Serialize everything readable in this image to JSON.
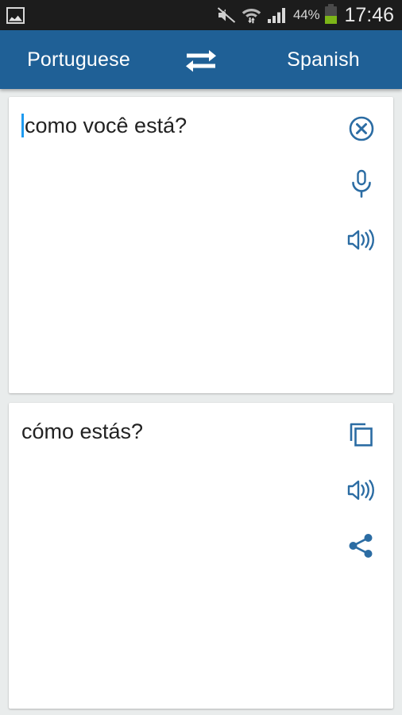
{
  "statusbar": {
    "notification_icon": "gallery-icon",
    "icons": [
      "volume-muted-icon",
      "wifi-icon",
      "signal-bars-icon"
    ],
    "battery_percent": "44%",
    "battery_level": 44,
    "time": "17:46"
  },
  "header": {
    "source_language": "Portuguese",
    "target_language": "Spanish",
    "swap_icon": "swap-arrows-icon",
    "background_color": "#1f6096"
  },
  "input_card": {
    "text": "como você está?",
    "caret_color": "#1e9bf0",
    "actions": [
      {
        "name": "clear-button",
        "icon": "close-circle-icon"
      },
      {
        "name": "voice-input-button",
        "icon": "microphone-icon"
      },
      {
        "name": "speak-source-button",
        "icon": "speaker-icon"
      }
    ]
  },
  "output_card": {
    "text": "cómo estás?",
    "actions": [
      {
        "name": "copy-button",
        "icon": "copy-icon"
      },
      {
        "name": "speak-translation-button",
        "icon": "speaker-icon"
      },
      {
        "name": "share-button",
        "icon": "share-icon"
      }
    ]
  },
  "colors": {
    "accent": "#2b6ca3",
    "header": "#1f6096",
    "page_background": "#e9ecec",
    "card_background": "#ffffff",
    "battery_fill": "#7cb518"
  }
}
